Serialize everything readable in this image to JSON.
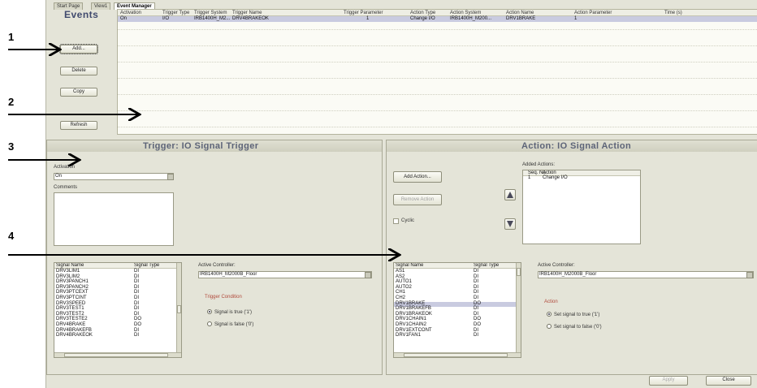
{
  "callouts": [
    "1",
    "2",
    "3",
    "4"
  ],
  "tabs": [
    "Start Page",
    "View1",
    "Event Manager"
  ],
  "events_title": "Events",
  "event_buttons": {
    "add": "Add...",
    "delete": "Delete",
    "copy": "Copy",
    "refresh": "Refresh"
  },
  "grid": {
    "columns": [
      "Activation",
      "Trigger Type",
      "Trigger System",
      "Trigger Name",
      "Trigger Parameter",
      "Action Type",
      "Action System",
      "Action Name",
      "Action Parameter",
      "Time (s)"
    ],
    "rows": [
      [
        "On",
        "I/O",
        "IRB1400H_M2...",
        "DRV4BRAKEOK",
        "1",
        "Change I/O",
        "IRB1400H_M200...",
        "DRV1BRAKE",
        "1",
        ""
      ]
    ]
  },
  "trigger": {
    "title": "Trigger: IO Signal Trigger",
    "activation_label": "Activation",
    "activation_value": "On",
    "comments_label": "Comments",
    "active_controller_label": "Active Controller:",
    "active_controller_value": "IRB1400H_M2000B_Floor",
    "condition_label": "Trigger Condition",
    "opt_true": "Signal is true ('1')",
    "opt_false": "Signal is false ('0')",
    "signals_header": [
      "Signal Name",
      "Signal Type"
    ],
    "signals": [
      [
        "DRV3LIM1",
        "DI"
      ],
      [
        "DRV3LIM2",
        "DI"
      ],
      [
        "DRV3PANCH1",
        "DI"
      ],
      [
        "DRV3PANCH2",
        "DI"
      ],
      [
        "DRV3PTCEXT",
        "DI"
      ],
      [
        "DRV3PTCINT",
        "DI"
      ],
      [
        "DRV3SPEED",
        "DI"
      ],
      [
        "DRV3TEST1",
        "DI"
      ],
      [
        "DRV3TEST2",
        "DI"
      ],
      [
        "DRV3TESTE2",
        "DO"
      ],
      [
        "DRV4BRAKE",
        "DO"
      ],
      [
        "DRV4BRAKEFB",
        "DI"
      ],
      [
        "DRV4BRAKEOK",
        "DI"
      ]
    ]
  },
  "action": {
    "title": "Action: IO Signal Action",
    "add_action": "Add Action...",
    "remove_action": "Remove Action",
    "cyclic_label": "Cyclic",
    "added_actions_label": "Added Actions:",
    "actions_header": [
      "Seq. No",
      "Action"
    ],
    "actions": [
      [
        "1",
        "Change I/O"
      ]
    ],
    "active_controller_label": "Active Controller:",
    "active_controller_value": "IRB1400H_M2000B_Floor",
    "action_label": "Action",
    "opt_true": "Set signal to true ('1')",
    "opt_false": "Set signal to false ('0')",
    "signals_header": [
      "Signal Name",
      "Signal Type"
    ],
    "signals": [
      [
        "AS1",
        "DI"
      ],
      [
        "AS2",
        "DI"
      ],
      [
        "AUTO1",
        "DI"
      ],
      [
        "AUTO2",
        "DI"
      ],
      [
        "CH1",
        "DI"
      ],
      [
        "CH2",
        "DI"
      ],
      [
        "DRV1BRAKE",
        "DO"
      ],
      [
        "DRV1BRAKEFB",
        "DI"
      ],
      [
        "DRV1BRAKEOK",
        "DI"
      ],
      [
        "DRV1CHAIN1",
        "DO"
      ],
      [
        "DRV1CHAIN2",
        "DO"
      ],
      [
        "DRV1EXTCONT",
        "DI"
      ],
      [
        "DRV1FAN1",
        "DI"
      ]
    ]
  },
  "footer": {
    "apply": "Apply",
    "close": "Close"
  },
  "colors": {
    "panel_bg": "#e4e4d8",
    "title": "#5d6478",
    "selected_row": "#c9cbe0"
  }
}
